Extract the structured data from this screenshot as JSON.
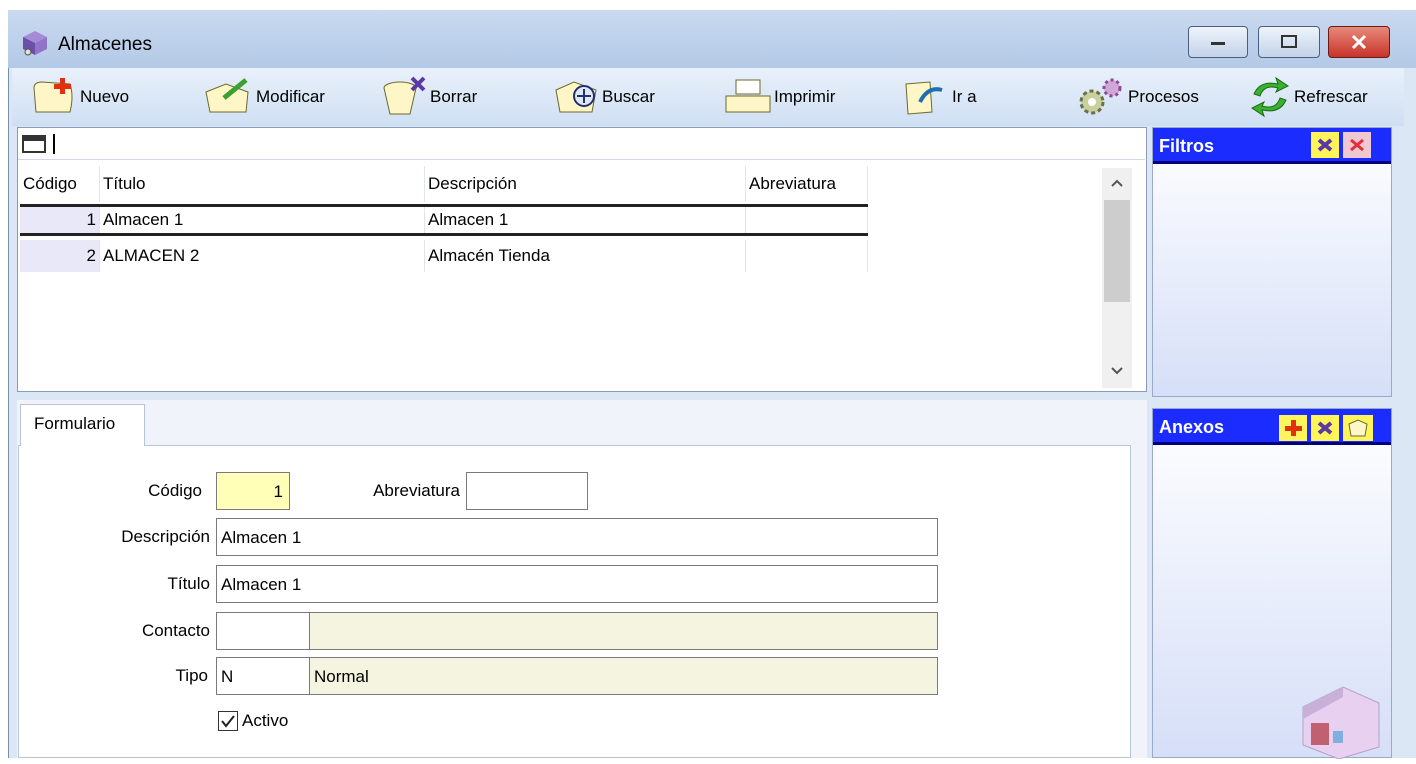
{
  "window": {
    "title": "Almacenes"
  },
  "toolbar": {
    "buttons": [
      {
        "label": "Nuevo"
      },
      {
        "label": "Modificar"
      },
      {
        "label": "Borrar"
      },
      {
        "label": "Buscar"
      },
      {
        "label": "Imprimir"
      },
      {
        "label": "Ir a"
      },
      {
        "label": "Procesos"
      },
      {
        "label": "Refrescar"
      }
    ]
  },
  "grid": {
    "columns": [
      "Código",
      "Título",
      "Descripción",
      "Abreviatura"
    ],
    "rows": [
      {
        "codigo": "1",
        "titulo": "Almacen 1",
        "descripcion": "Almacen 1",
        "abreviatura": ""
      },
      {
        "codigo": "2",
        "titulo": "ALMACEN 2",
        "descripcion": "Almacén Tienda",
        "abreviatura": ""
      }
    ]
  },
  "panels": {
    "filtros": "Filtros",
    "anexos": "Anexos"
  },
  "form": {
    "tab": "Formulario",
    "codigo_label": "Código",
    "codigo_value": "1",
    "abreviatura_label": "Abreviatura",
    "abreviatura_value": "",
    "descripcion_label": "Descripción",
    "descripcion_value": "Almacen 1",
    "titulo_label": "Título",
    "titulo_value": "Almacen 1",
    "contacto_label": "Contacto",
    "contacto_code": "",
    "contacto_desc": "",
    "tipo_label": "Tipo",
    "tipo_code": "N",
    "tipo_desc": "Normal",
    "activo_label": "Activo",
    "activo_checked": true
  },
  "colors": {
    "panel_header": "#1a2cff",
    "code_field": "#ffffb8",
    "lookup_field": "#f4f4e0"
  }
}
